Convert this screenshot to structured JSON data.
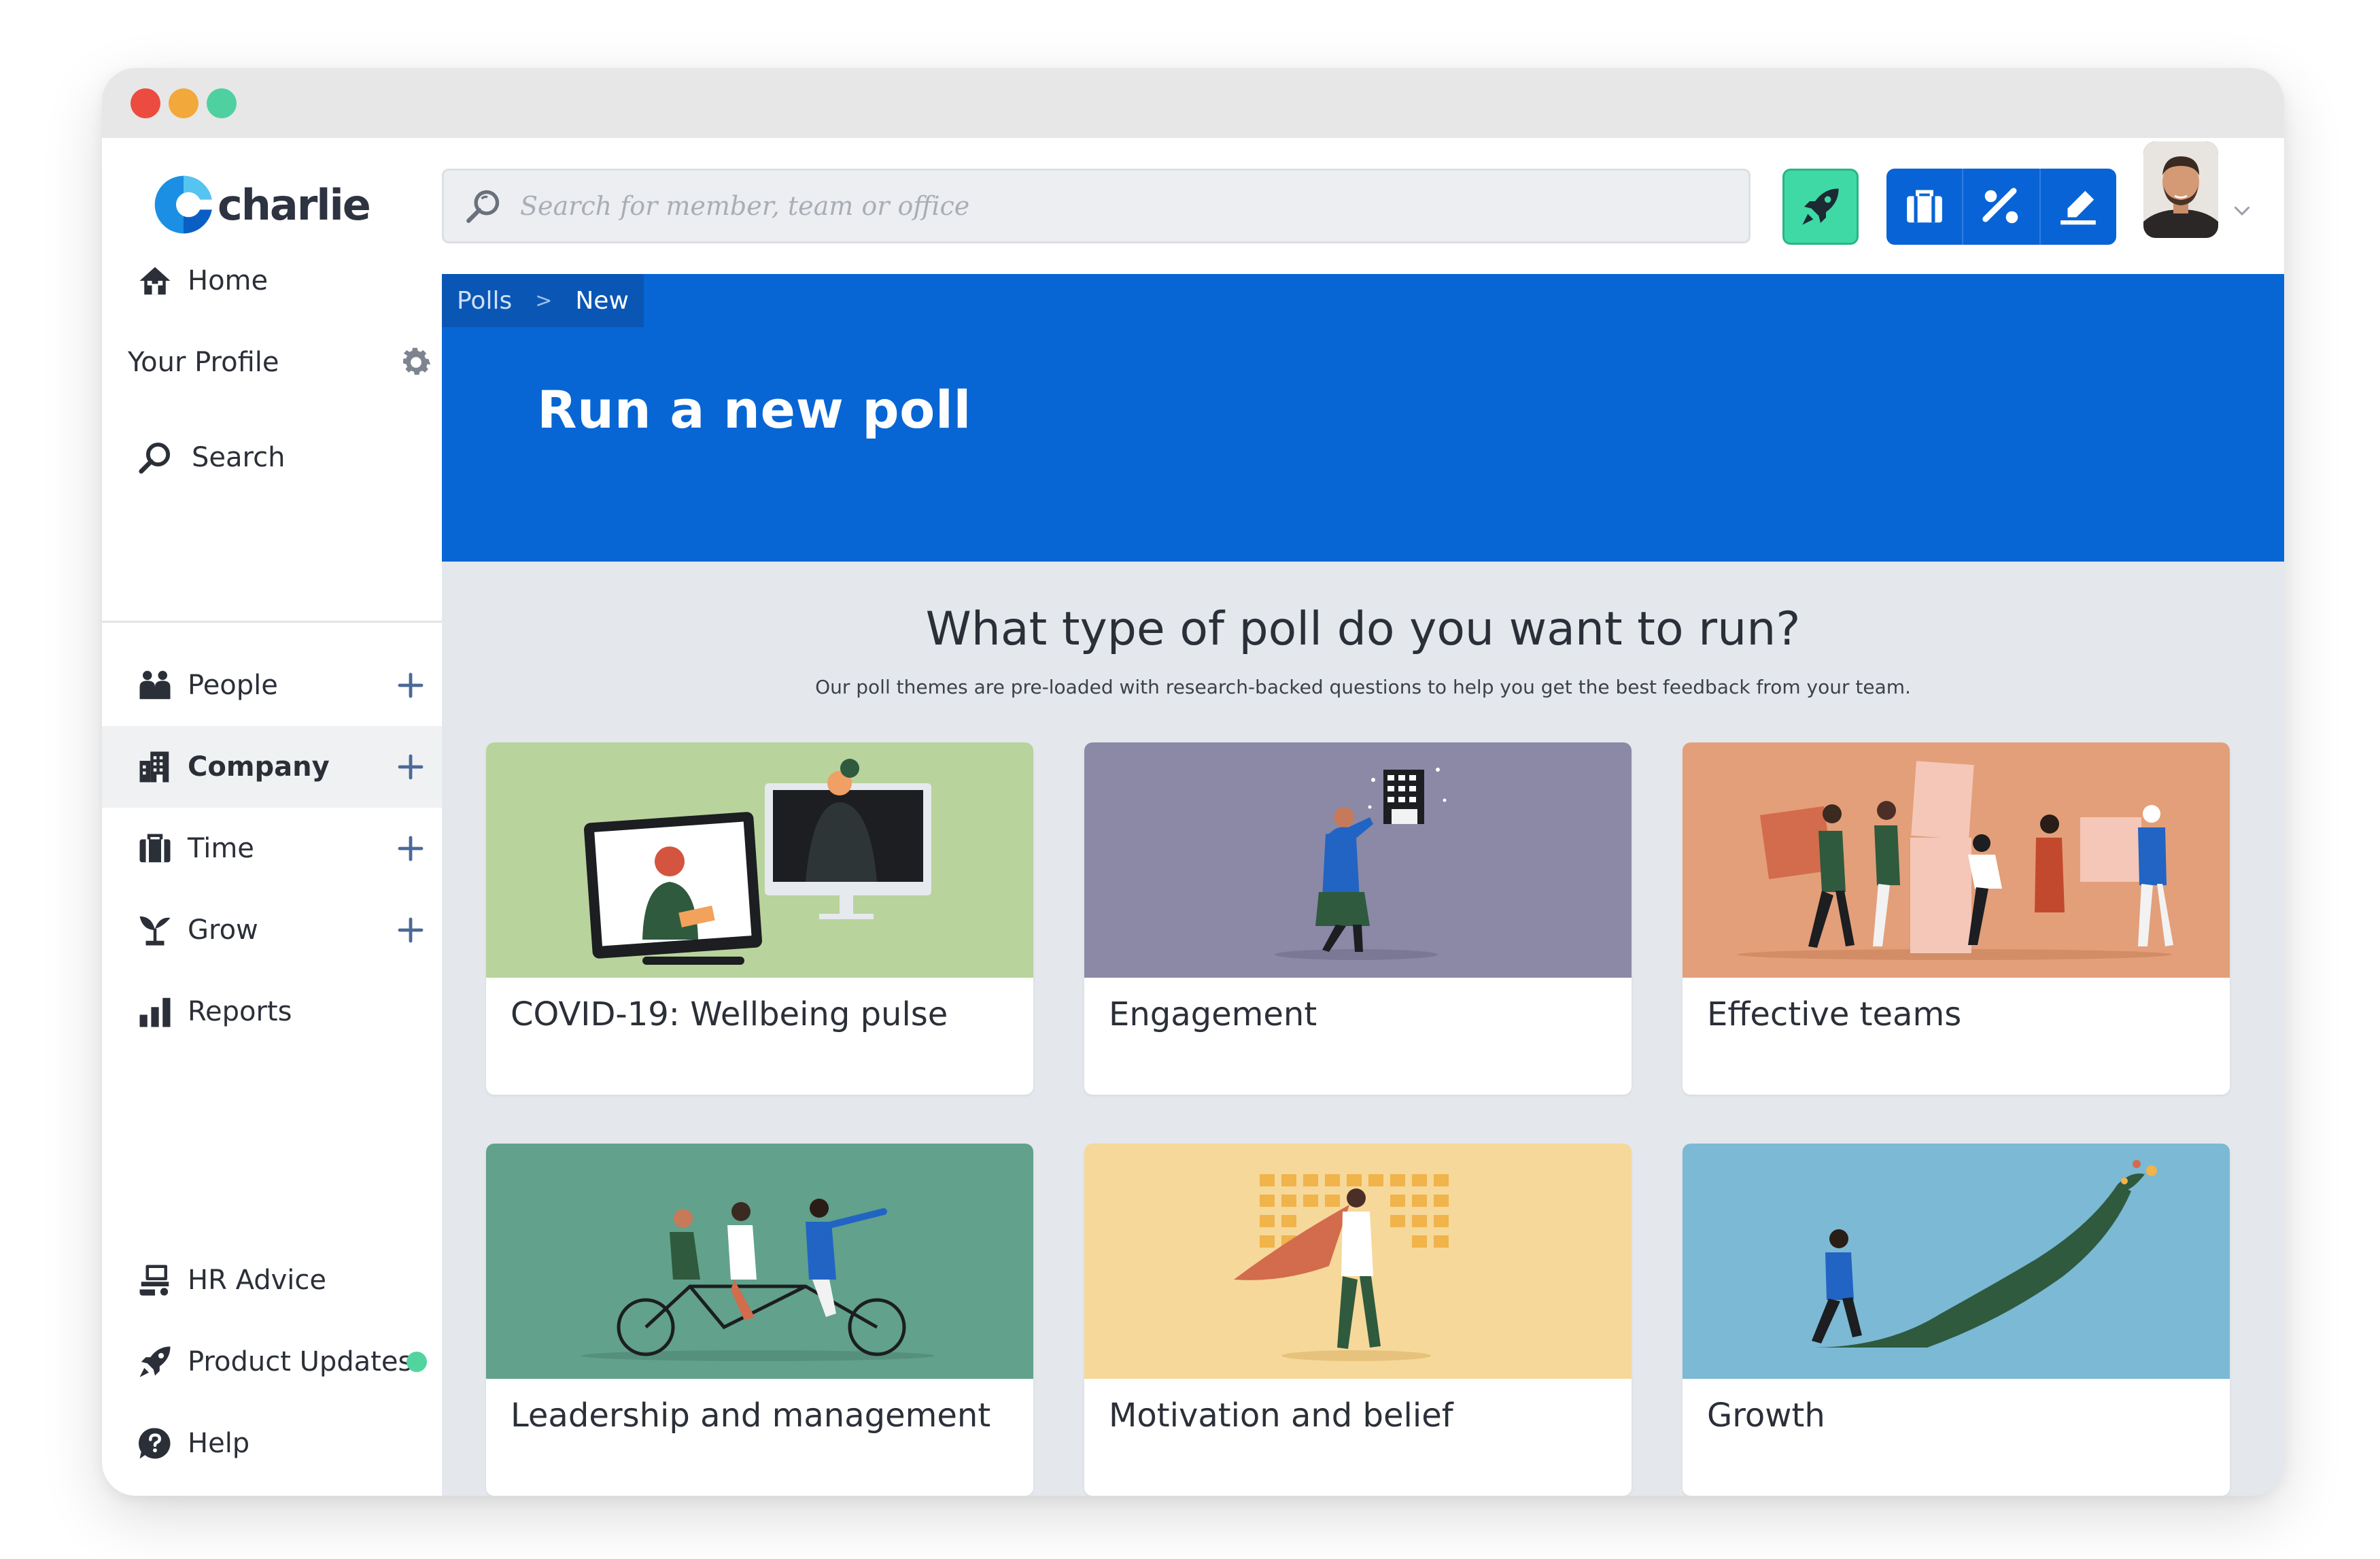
{
  "brand": {
    "name": "charlie"
  },
  "sidebar": {
    "top_items": [
      {
        "label": "Home",
        "icon": "home-icon"
      },
      {
        "label": "Your Profile",
        "icon": "gear-icon"
      },
      {
        "label": "Search",
        "icon": "search-icon"
      }
    ],
    "main_items": [
      {
        "label": "People",
        "icon": "people-icon",
        "has_add": true
      },
      {
        "label": "Company",
        "icon": "building-icon",
        "has_add": true,
        "active": true
      },
      {
        "label": "Time",
        "icon": "suitcase-icon",
        "has_add": true
      },
      {
        "label": "Grow",
        "icon": "plant-icon",
        "has_add": true
      },
      {
        "label": "Reports",
        "icon": "bar-chart-icon",
        "has_add": false
      }
    ],
    "bottom_items": [
      {
        "label": "HR Advice",
        "icon": "hr-advice-icon"
      },
      {
        "label": "Product Updates",
        "icon": "rocket-icon",
        "has_update_dot": true
      },
      {
        "label": "Help",
        "icon": "help-icon"
      }
    ]
  },
  "search": {
    "placeholder": "Search for member, team or office",
    "value": ""
  },
  "toolbar": {
    "quick_action_icon": "rocket-icon",
    "action_icons": [
      "suitcase-icon",
      "percent-icon",
      "sign-icon"
    ]
  },
  "breadcrumb": {
    "parent": "Polls",
    "separator": ">",
    "current": "New"
  },
  "page": {
    "title": "Run a new poll",
    "question": "What type of poll do you want to run?",
    "subtitle": "Our poll themes are pre-loaded with research-backed questions to help you get the best feedback from your team."
  },
  "poll_types": [
    {
      "label": "COVID-19: Wellbeing pulse",
      "bg": "#b8d39c"
    },
    {
      "label": "Engagement",
      "bg": "#8b89a6"
    },
    {
      "label": "Effective teams",
      "bg": "#e39f79"
    },
    {
      "label": "Leadership and management",
      "bg": "#62a18b"
    },
    {
      "label": "Motivation and belief",
      "bg": "#f6d89a"
    },
    {
      "label": "Growth",
      "bg": "#7bb9d5"
    }
  ],
  "colors": {
    "primary_blue": "#0766d4",
    "accent_green": "#3fd9a6",
    "content_bg": "#e4e8ec"
  }
}
